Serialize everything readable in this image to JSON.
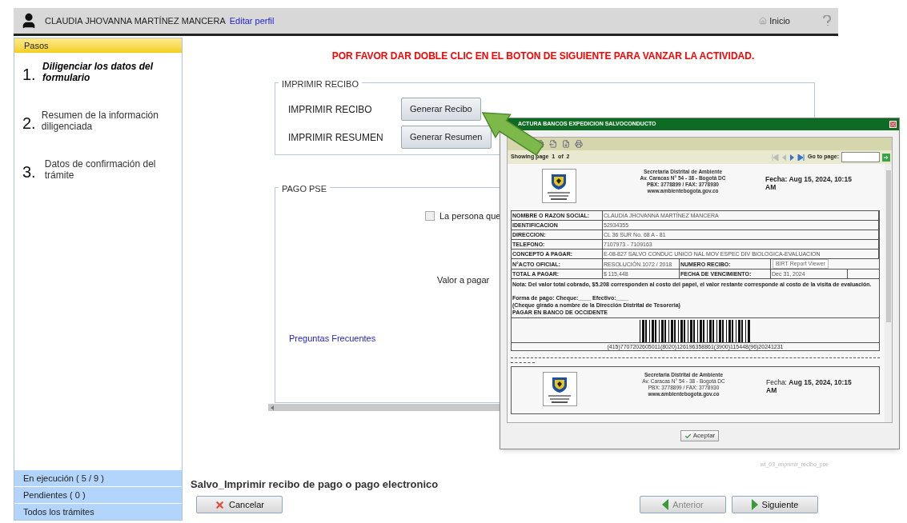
{
  "header": {
    "user_name": "CLAUDIA JHOVANNA MARTÍNEZ MANCERA",
    "edit_link": "Editar perfil",
    "home_label": "Inicio"
  },
  "sidebar": {
    "title": "Pasos",
    "steps": [
      {
        "number": "1.",
        "label": "Diligenciar los datos del formulario",
        "selected": true
      },
      {
        "number": "2.",
        "label": "Resumen de la información diligenciada",
        "selected": false
      },
      {
        "number": "3.",
        "label": "Datos de confirmación del trámite",
        "selected": false
      }
    ],
    "footer_items": [
      "En ejecución ( 5 / 9 )",
      "Pendientes ( 0 )",
      "Todos los trámites"
    ]
  },
  "main": {
    "notice": "POR FAVOR DAR DOBLE CLIC EN EL BOTON DE SIGUIENTE PARA VANZAR LA ACTIVIDAD.",
    "print_section": {
      "legend": "IMPRIMIR RECIBO",
      "rows": [
        {
          "label": "IMPRIMIR RECIBO",
          "button": "Generar Recibo"
        },
        {
          "label": "IMPRIMIR RESUMEN",
          "button": "Generar Resumen"
        }
      ]
    },
    "payment_section": {
      "legend": "PAGO PSE",
      "checkbox": {
        "label": "La persona que",
        "checked": false
      },
      "value_label": "Valor a pagar",
      "faq_link": "Preguntas Frecuentes"
    },
    "form_id": "wf_03_imprimir_recibo_pse",
    "page_title": "Salvo_Imprimir recibo de pago o pago electronico",
    "buttons": [
      {
        "kind": "cancel",
        "label": "Cancelar",
        "disabled": false
      },
      {
        "kind": "previous",
        "label": "Anterior",
        "disabled": true
      },
      {
        "kind": "next",
        "label": "Siguiente",
        "disabled": false
      }
    ]
  },
  "dialog": {
    "title": "ACTURA BANCOS EXPEDICION SALVOCONDUCTO",
    "page_info": "Showing page  1  of  2",
    "goto_label": "Go to page:",
    "pages": [
      {
        "org_lines": [
          "Secretaria Distrital de Ambiente",
          "Av. Caracas N° 54 - 38 - Bogotá DC",
          "PBX: 3778899 / FAX: 3778930",
          "www.ambientebogota.gov.co"
        ],
        "fecha": "Fecha: Aug 15, 2024, 10:15 AM",
        "fecha_bold": true
      },
      {
        "org_lines": [
          "Secretaria Distrital de Ambiente",
          "Av. Caracas N° 54 - 38 - Bogotá DC",
          "PBX: 3778899 / FAX: 3778930",
          "www.ambientebogota.gov.co"
        ],
        "fecha": "Fecha: **Aug 15, 2024, 10:15 AM**",
        "fecha_bold": false
      }
    ],
    "table": [
      [
        "NOMBRE O RAZON SOCIAL:",
        "CLAUDIA JHOVANNA MARTÍNEZ MANCERA"
      ],
      [
        "IDENTIFICACION",
        "52934355"
      ],
      [
        "DIRECCION:",
        "CL 36 SUR No. 68 A - 81"
      ],
      [
        "TELEFONO:",
        "7107973 - 7109163"
      ],
      [
        "CONCEPTO A PAGAR:",
        "E-08-827 SALVO CONDUC UNICO NAL MOV ESPEC DIV BIOLOGICA-EVALUACION"
      ],
      [
        "N°ACTO OFICIAL:",
        "RESOLUCIÓN 1072 / 2018",
        "NUMERO RECIBO:"
      ],
      [
        "TOTAL A PAGAR:",
        "$ 115,448",
        "FECHA DE VENCIMIENTO:",
        "Dec 31, 2024"
      ]
    ],
    "tooltip": "BIRT Report Viewer",
    "note": "Nota: Del valor total cobrado, $5.208 corresponden al costo del papel, el valor restante corresponde al costo de la visita de evaluación.",
    "payment_lines": [
      "Forma de pago: Cheque:____ Efectivo:____",
      "(Cheque girado a nombre de la Dirección Distrital de Tesoreria)",
      "PAGAR EN BANCO DE OCCIDENTE"
    ],
    "barcode_text": "(415)7707202605011(8020)126196358861(3900)115448(96)20241231",
    "accept": "Aceptar"
  }
}
